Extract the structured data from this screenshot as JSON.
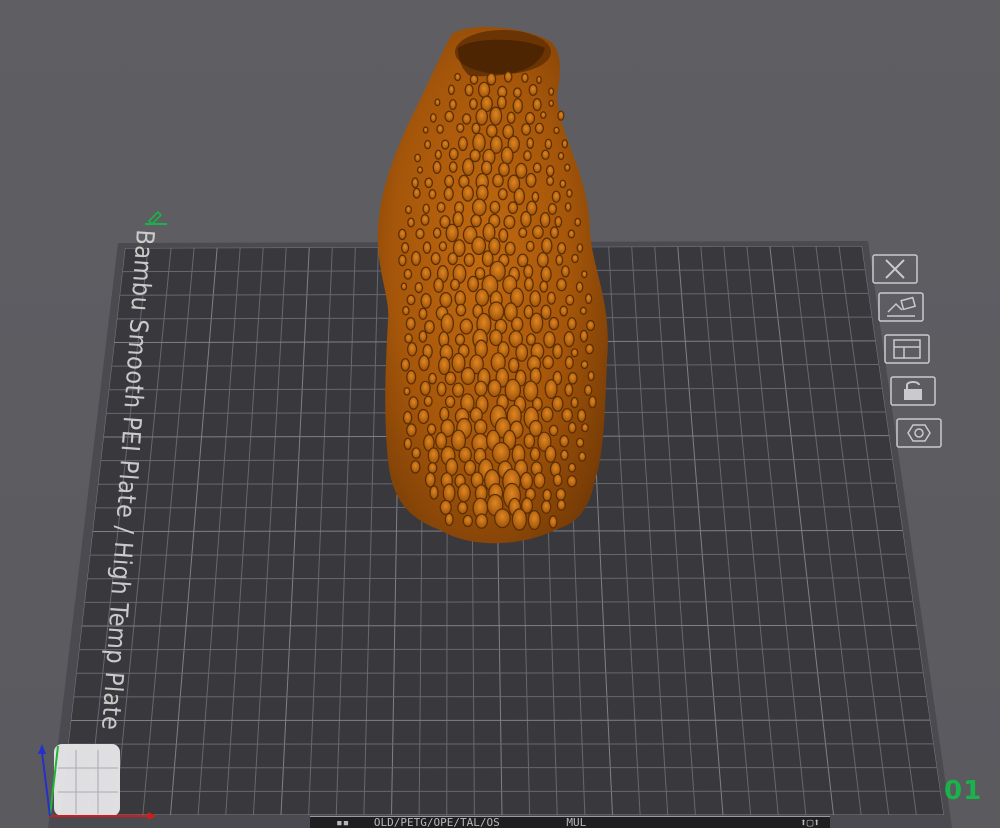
{
  "viewport": {
    "plate_label": "Bambu Smooth PEI Plate / High Temp Plate",
    "plate_number": "01",
    "background_color": "#5b5b60",
    "bed_color": "#36363b",
    "grid_color": "#7a7a80",
    "model_color": "#a85a06"
  },
  "toolbar": {
    "items": [
      {
        "name": "close-icon"
      },
      {
        "name": "arrange-icon"
      },
      {
        "name": "layout-icon"
      },
      {
        "name": "lock-icon"
      },
      {
        "name": "settings-hex-icon"
      }
    ]
  },
  "gizmo": {
    "x_color": "#d11c1c",
    "y_color": "#22b33a",
    "z_color": "#2431c9"
  },
  "status_bar": {
    "path_text": "OLD/PETG/OPE/TAL/OS",
    "mode_text": "MUL"
  },
  "accent_color": "#19b34a"
}
